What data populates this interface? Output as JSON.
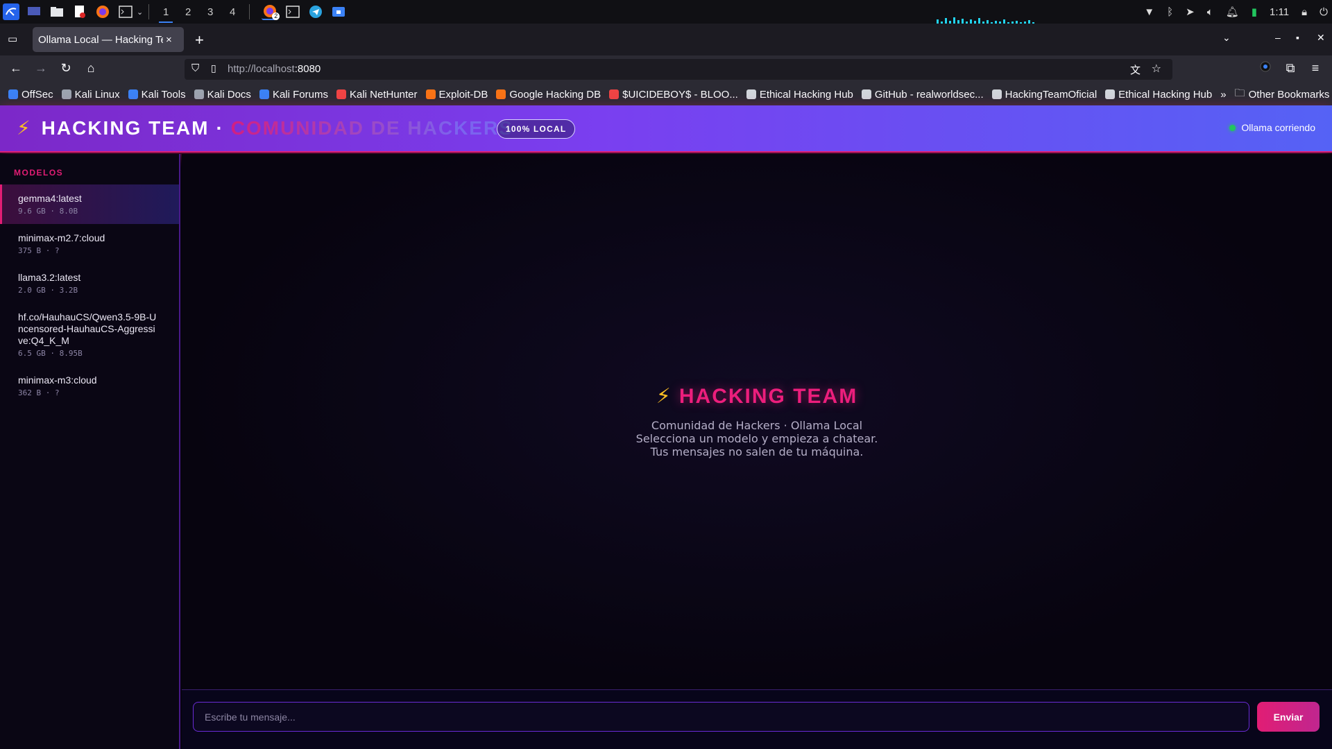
{
  "taskbar": {
    "workspaces": [
      "1",
      "2",
      "3",
      "4"
    ],
    "active_workspace": "1",
    "clock": "1:11",
    "notification_count": "2"
  },
  "browser": {
    "tab_title": "Ollama Local — Hacking Team",
    "tab_close": "×",
    "new_tab": "+",
    "url_host": "http://localhost",
    "url_port": ":8080",
    "bookmarks": [
      {
        "label": "OffSec",
        "color": "#3b82f6"
      },
      {
        "label": "Kali Linux",
        "color": "#9ca3af"
      },
      {
        "label": "Kali Tools",
        "color": "#3b82f6"
      },
      {
        "label": "Kali Docs",
        "color": "#9ca3af"
      },
      {
        "label": "Kali Forums",
        "color": "#3b82f6"
      },
      {
        "label": "Kali NetHunter",
        "color": "#ef4444"
      },
      {
        "label": "Exploit-DB",
        "color": "#f97316"
      },
      {
        "label": "Google Hacking DB",
        "color": "#f97316"
      },
      {
        "label": "$UICIDEBOY$ - BLOO...",
        "color": "#ef4444"
      },
      {
        "label": "Ethical Hacking Hub",
        "color": "#d1d5db"
      },
      {
        "label": "GitHub - realworldsec...",
        "color": "#d1d5db"
      },
      {
        "label": "HackingTeamOficial",
        "color": "#d1d5db"
      },
      {
        "label": "Ethical Hacking Hub",
        "color": "#d1d5db"
      }
    ],
    "overflow": "»",
    "other_bookmarks": "Other Bookmarks"
  },
  "header": {
    "bolt": "⚡",
    "brand": "HACKING TEAM",
    "separator": "·",
    "subtitle": "COMUNIDAD DE HACKERS",
    "badge": "100% LOCAL",
    "status": "Ollama corriendo",
    "status_color": "#22c55e"
  },
  "sidebar": {
    "title": "MODELOS",
    "models": [
      {
        "name": "gemma4:latest",
        "meta": "9.6 GB · 8.0B",
        "active": true
      },
      {
        "name": "minimax-m2.7:cloud",
        "meta": "375 B · ?",
        "active": false
      },
      {
        "name": "llama3.2:latest",
        "meta": "2.0 GB · 3.2B",
        "active": false
      },
      {
        "name": "hf.co/HauhauCS/Qwen3.5-9B-Uncensored-HauhauCS-Aggressive:Q4_K_M",
        "meta": "6.5 GB · 8.95B",
        "active": false
      },
      {
        "name": "minimax-m3:cloud",
        "meta": "362 B · ?",
        "active": false
      }
    ]
  },
  "welcome": {
    "bolt": "⚡",
    "title": "HACKING TEAM",
    "line1": "Comunidad de Hackers · Ollama Local",
    "line2": "Selecciona un modelo y empieza a chatear.",
    "line3": "Tus mensajes no salen de tu máquina."
  },
  "composer": {
    "placeholder": "Escribe tu mensaje...",
    "send_label": "Enviar"
  },
  "colors": {
    "accent": "#e11d74",
    "header_start": "#7c28c8",
    "header_end": "#5562f5"
  }
}
